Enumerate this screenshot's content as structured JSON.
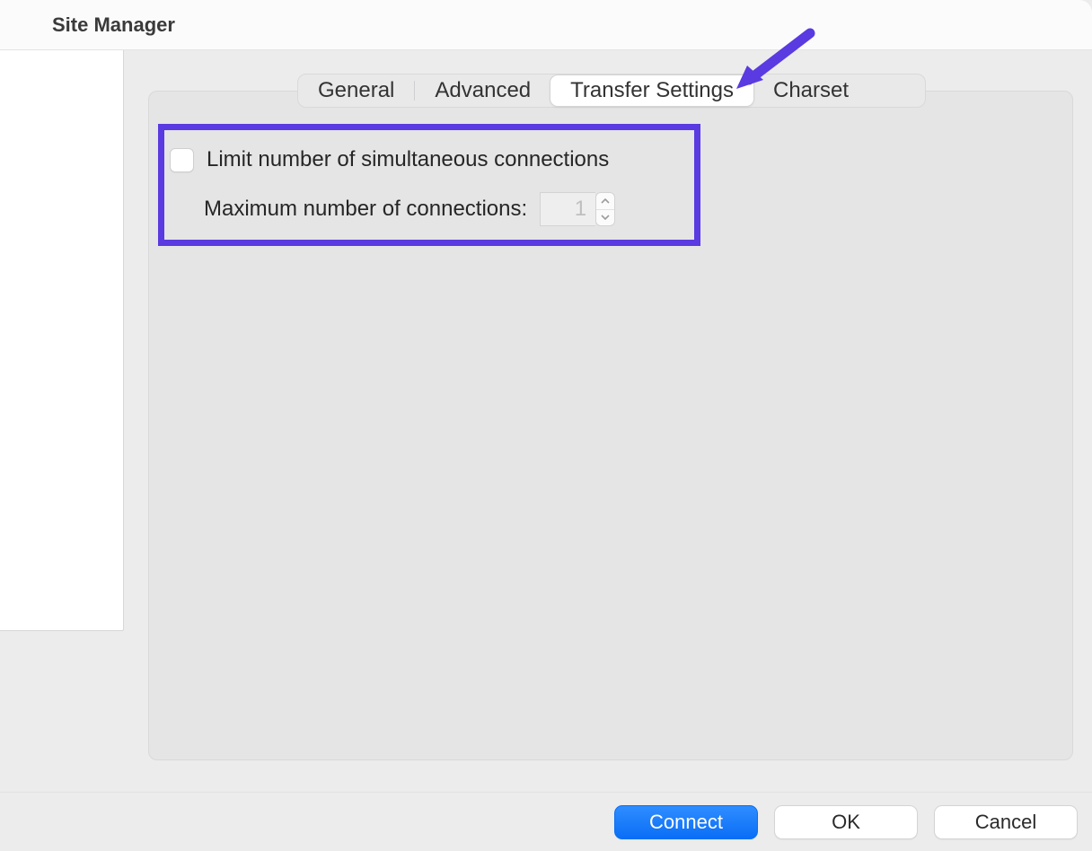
{
  "window": {
    "title": "Site Manager"
  },
  "tabs": {
    "general": "General",
    "advanced": "Advanced",
    "transfer_settings": "Transfer Settings",
    "charset": "Charset"
  },
  "settings": {
    "limit_label": "Limit number of simultaneous connections",
    "max_label": "Maximum number of connections:",
    "max_value": "1"
  },
  "buttons": {
    "connect": "Connect",
    "ok": "OK",
    "cancel": "Cancel"
  },
  "annotation": {
    "highlight_color": "#5a3ae1"
  }
}
